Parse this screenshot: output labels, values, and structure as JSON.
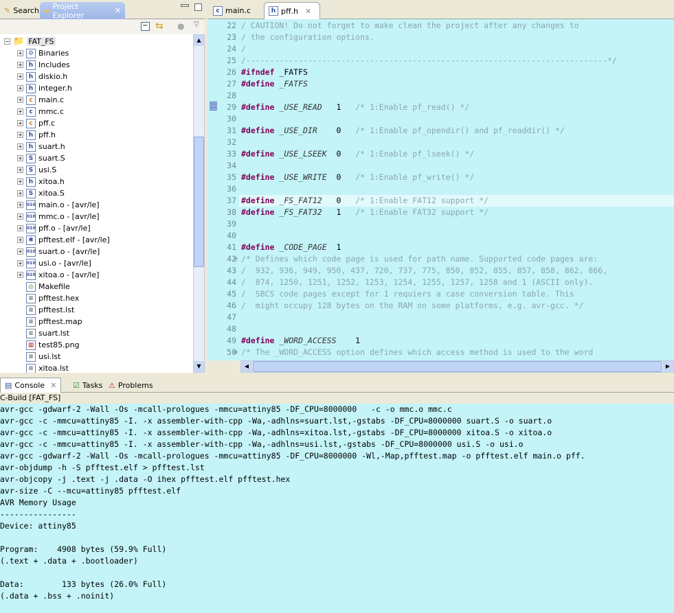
{
  "left_tabs": {
    "search": "Search",
    "project_explorer": "Project Explorer"
  },
  "editor_tabs": [
    {
      "label": "main.c"
    },
    {
      "label": "pff.h"
    }
  ],
  "tree": {
    "root": "FAT_FS",
    "items": [
      {
        "label": "Binaries",
        "icon": "binaries",
        "expandable": true
      },
      {
        "label": "Includes",
        "icon": "includes",
        "expandable": true
      },
      {
        "label": "diskio.h",
        "icon": "h",
        "expandable": true
      },
      {
        "label": "integer.h",
        "icon": "h",
        "expandable": true
      },
      {
        "label": "main.c",
        "icon": "c-warn",
        "expandable": true
      },
      {
        "label": "mmc.c",
        "icon": "c",
        "expandable": true
      },
      {
        "label": "pff.c",
        "icon": "c-warn",
        "expandable": true
      },
      {
        "label": "pff.h",
        "icon": "h",
        "expandable": true
      },
      {
        "label": "suart.h",
        "icon": "h",
        "expandable": true
      },
      {
        "label": "suart.S",
        "icon": "S",
        "expandable": true
      },
      {
        "label": "usi.S",
        "icon": "S",
        "expandable": true
      },
      {
        "label": "xitoa.h",
        "icon": "h",
        "expandable": true
      },
      {
        "label": "xitoa.S",
        "icon": "S",
        "expandable": true
      },
      {
        "label": "main.o - [avr/le]",
        "icon": "o",
        "expandable": true
      },
      {
        "label": "mmc.o - [avr/le]",
        "icon": "o",
        "expandable": true
      },
      {
        "label": "pff.o - [avr/le]",
        "icon": "o",
        "expandable": true
      },
      {
        "label": "pfftest.elf - [avr/le]",
        "icon": "elf",
        "expandable": true
      },
      {
        "label": "suart.o - [avr/le]",
        "icon": "o",
        "expandable": true
      },
      {
        "label": "usi.o - [avr/le]",
        "icon": "o",
        "expandable": true
      },
      {
        "label": "xitoa.o - [avr/le]",
        "icon": "o",
        "expandable": true
      },
      {
        "label": "Makefile",
        "icon": "make",
        "expandable": false
      },
      {
        "label": "pfftest.hex",
        "icon": "file",
        "expandable": false
      },
      {
        "label": "pfftest.lst",
        "icon": "file",
        "expandable": false
      },
      {
        "label": "pfftest.map",
        "icon": "file",
        "expandable": false
      },
      {
        "label": "suart.lst",
        "icon": "file",
        "expandable": false
      },
      {
        "label": "test85.png",
        "icon": "image",
        "expandable": false
      },
      {
        "label": "usi.lst",
        "icon": "file",
        "expandable": false
      },
      {
        "label": "xitoa.lst",
        "icon": "file",
        "expandable": false
      }
    ]
  },
  "editor": {
    "current_line": 37,
    "lines": [
      {
        "n": "22",
        "parts": [
          [
            "cm",
            "/ CAUTION! Do not forget to make clean the project after any changes to"
          ]
        ]
      },
      {
        "n": "23",
        "parts": [
          [
            "cm",
            "/ the configuration options."
          ]
        ]
      },
      {
        "n": "24",
        "parts": [
          [
            "cm",
            "/"
          ]
        ]
      },
      {
        "n": "25",
        "parts": [
          [
            "cm",
            "/----------------------------------------------------------------------------*/"
          ]
        ]
      },
      {
        "n": "26",
        "parts": [
          [
            "kw",
            "#ifndef"
          ],
          [
            "num",
            " _FATFS"
          ]
        ]
      },
      {
        "n": "27",
        "parts": [
          [
            "kw",
            "#define"
          ],
          [
            "mac",
            " _FATFS"
          ]
        ]
      },
      {
        "n": "28",
        "parts": []
      },
      {
        "n": "29",
        "parts": [
          [
            "kw",
            "#define"
          ],
          [
            "mac",
            " _USE_READ"
          ],
          [
            "num",
            "   1"
          ],
          [
            "cm",
            "   /* 1:Enable pf_read() */"
          ]
        ]
      },
      {
        "n": "30",
        "parts": []
      },
      {
        "n": "31",
        "parts": [
          [
            "kw",
            "#define"
          ],
          [
            "mac",
            " _USE_DIR"
          ],
          [
            "num",
            "    0"
          ],
          [
            "cm",
            "   /* 1:Enable pf_opendir() and pf_readdir() */"
          ]
        ]
      },
      {
        "n": "32",
        "parts": []
      },
      {
        "n": "33",
        "parts": [
          [
            "kw",
            "#define"
          ],
          [
            "mac",
            " _USE_LSEEK"
          ],
          [
            "num",
            "  0"
          ],
          [
            "cm",
            "   /* 1:Enable pf_lseek() */"
          ]
        ]
      },
      {
        "n": "34",
        "parts": []
      },
      {
        "n": "35",
        "parts": [
          [
            "kw",
            "#define"
          ],
          [
            "mac",
            " _USE_WRITE"
          ],
          [
            "num",
            "  0"
          ],
          [
            "cm",
            "   /* 1:Enable pf_write() */"
          ]
        ]
      },
      {
        "n": "36",
        "parts": []
      },
      {
        "n": "37",
        "parts": [
          [
            "kw",
            "#define"
          ],
          [
            "mac",
            " _FS_FAT12"
          ],
          [
            "num",
            "   0"
          ],
          [
            "cm",
            "   /* 1:Enable FAT12 support */"
          ]
        ]
      },
      {
        "n": "38",
        "parts": [
          [
            "kw",
            "#define"
          ],
          [
            "mac",
            " _FS_FAT32"
          ],
          [
            "num",
            "   1"
          ],
          [
            "cm",
            "   /* 1:Enable FAT32 support */"
          ]
        ]
      },
      {
        "n": "39",
        "parts": []
      },
      {
        "n": "40",
        "parts": []
      },
      {
        "n": "41",
        "parts": [
          [
            "kw",
            "#define"
          ],
          [
            "mac",
            " _CODE_PAGE"
          ],
          [
            "num",
            "  1"
          ]
        ]
      },
      {
        "n": "42",
        "parts": [
          [
            "cm",
            "/* Defines which code page is used for path name. Supported code pages are:"
          ]
        ]
      },
      {
        "n": "43",
        "parts": [
          [
            "cm",
            "/  932, 936, 949, 950, 437, 720, 737, 775, 850, 852, 855, 857, 858, 862, 866,"
          ]
        ]
      },
      {
        "n": "44",
        "parts": [
          [
            "cm",
            "/  874, 1250, 1251, 1252, 1253, 1254, 1255, 1257, 1258 and 1 (ASCII only)."
          ]
        ]
      },
      {
        "n": "45",
        "parts": [
          [
            "cm",
            "/  SBCS code pages except for 1 requiers a case conversion table. This"
          ]
        ]
      },
      {
        "n": "46",
        "parts": [
          [
            "cm",
            "/  might occupy 128 bytes on the RAM on some platforms, e.g. avr-gcc. */"
          ]
        ]
      },
      {
        "n": "47",
        "parts": []
      },
      {
        "n": "48",
        "parts": []
      },
      {
        "n": "49",
        "parts": [
          [
            "kw",
            "#define"
          ],
          [
            "mac",
            " _WORD_ACCESS"
          ],
          [
            "num",
            "    1"
          ]
        ]
      },
      {
        "n": "50",
        "parts": [
          [
            "cm",
            "/* The _WORD_ACCESS option defines which access method is used to the word"
          ]
        ]
      }
    ]
  },
  "console_tabs": {
    "console": "Console",
    "tasks": "Tasks",
    "problems": "Problems"
  },
  "console": {
    "title": "C-Build [FAT_FS]",
    "lines": [
      "avr-gcc -gdwarf-2 -Wall -Os -mcall-prologues -mmcu=attiny85 -DF_CPU=8000000   -c -o mmc.o mmc.c",
      "avr-gcc -c -mmcu=attiny85 -I. -x assembler-with-cpp -Wa,-adhlns=suart.lst,-gstabs -DF_CPU=8000000 suart.S -o suart.o",
      "avr-gcc -c -mmcu=attiny85 -I. -x assembler-with-cpp -Wa,-adhlns=xitoa.lst,-gstabs -DF_CPU=8000000 xitoa.S -o xitoa.o",
      "avr-gcc -c -mmcu=attiny85 -I. -x assembler-with-cpp -Wa,-adhlns=usi.lst,-gstabs -DF_CPU=8000000 usi.S -o usi.o",
      "avr-gcc -gdwarf-2 -Wall -Os -mcall-prologues -mmcu=attiny85 -DF_CPU=8000000 -Wl,-Map,pfftest.map -o pfftest.elf main.o pff.",
      "avr-objdump -h -S pfftest.elf > pfftest.lst",
      "avr-objcopy -j .text -j .data -O ihex pfftest.elf pfftest.hex",
      "avr-size -C --mcu=attiny85 pfftest.elf",
      "AVR Memory Usage",
      "----------------",
      "Device: attiny85",
      "",
      "Program:    4908 bytes (59.9% Full)",
      "(.text + .data + .bootloader)",
      "",
      "Data:        133 bytes (26.0% Full)",
      "(.data + .bss + .noinit)"
    ]
  }
}
